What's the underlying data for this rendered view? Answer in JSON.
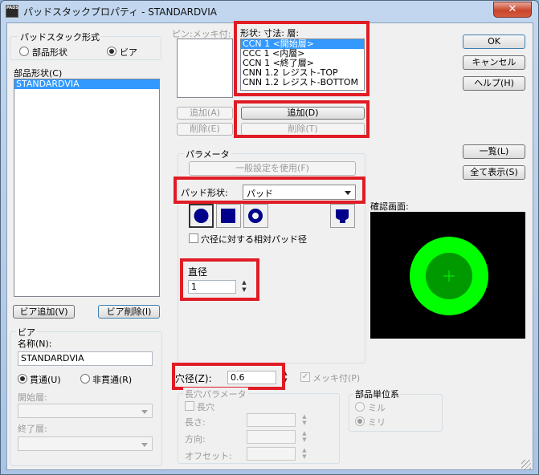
{
  "window": {
    "title": "パッドスタックプロパティ - STANDARDVIA",
    "app_icon_text": "PADS",
    "close_glyph": "✕"
  },
  "padstack_format": {
    "title": "パッドスタック形式",
    "option_part": "部品形状",
    "option_via": "ビア",
    "selected": "ビア"
  },
  "part_shape": {
    "label": "部品形状(C)",
    "items": [
      "STANDARDVIA"
    ]
  },
  "via_buttons": {
    "add": "ビア追加(V)",
    "delete": "ビア削除(I)"
  },
  "pin_plating": {
    "label": "ピン:メッキ付:",
    "add": "追加(A)",
    "delete": "削除(E)"
  },
  "layers": {
    "label": "形状: 寸法: 層:",
    "items": [
      "CCN 1 <開始層>",
      "CCC 1 <内層>",
      "CCN 1 <終了層>",
      "CNN 1.2 レジスト-TOP",
      "CNN 1.2 レジスト-BOTTOM"
    ],
    "selected_index": 0,
    "add": "追加(D)",
    "delete": "削除(T)"
  },
  "right_buttons": {
    "ok": "OK",
    "cancel": "キャンセル",
    "help": "ヘルプ(H)",
    "list": "一覧(L)",
    "show_all": "全て表示(S)"
  },
  "parameters": {
    "title": "パラメータ",
    "use_general": "一般設定を使用(F)",
    "pad_shape_label": "パッド形状:",
    "pad_shape_value": "パッド",
    "relative_checkbox": "穴径に対する相対パッド径",
    "diameter_label": "直径",
    "diameter_value": "1"
  },
  "preview": {
    "label": "確認画面:",
    "bg_color": "#000000",
    "outer_color": "#00ff00",
    "inner_color": "#009900"
  },
  "via": {
    "title": "ビア",
    "name_label": "名称(N):",
    "name_value": "STANDARDVIA",
    "through": "貫通(U)",
    "non_through": "非貫通(R)",
    "selected": "貫通(U)",
    "start_layer": "開始層:",
    "end_layer": "終了層:"
  },
  "drill": {
    "label": "穴径(Z):",
    "value": "0.6",
    "plated": "メッキ付(P)"
  },
  "slot": {
    "title": "長穴パラメータ",
    "slot_checkbox": "長穴",
    "length": "長さ:",
    "direction": "方向:",
    "offset": "オフセット:"
  },
  "units": {
    "title": "部品単位系",
    "mil": "ミル",
    "metric": "ミリ",
    "selected": "ミリ"
  }
}
